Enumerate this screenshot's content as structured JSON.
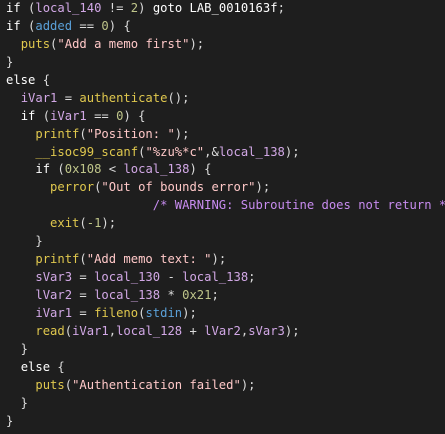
{
  "colors": {
    "background": "#1e1e1e",
    "keyword": "#ffffff",
    "function": "#e0c84e",
    "variable": "#d2a8e6",
    "global": "#5aa0d8",
    "number": "#bfc58a",
    "string": "#ffc8c8",
    "comment": "#c88cf0",
    "operator": "#dcdcdc"
  },
  "code_lines": [
    [
      [
        "kw",
        "if"
      ],
      [
        "op",
        " ("
      ],
      [
        "var",
        "local_140"
      ],
      [
        "op",
        " != "
      ],
      [
        "num",
        "2"
      ],
      [
        "op",
        ") "
      ],
      [
        "kw",
        "goto"
      ],
      [
        "label",
        " LAB_0010163f"
      ],
      [
        "op",
        ";"
      ]
    ],
    [
      [
        "kw",
        "if"
      ],
      [
        "op",
        " ("
      ],
      [
        "gvar",
        "added"
      ],
      [
        "op",
        " == "
      ],
      [
        "num",
        "0"
      ],
      [
        "op",
        ") {"
      ]
    ],
    [
      [
        "op",
        "  "
      ],
      [
        "fn",
        "puts"
      ],
      [
        "op",
        "("
      ],
      [
        "str",
        "\"Add a memo first\""
      ],
      [
        "op",
        ");"
      ]
    ],
    [
      [
        "op",
        "}"
      ]
    ],
    [
      [
        "kw",
        "else"
      ],
      [
        "op",
        " {"
      ]
    ],
    [
      [
        "op",
        "  "
      ],
      [
        "var",
        "iVar1"
      ],
      [
        "op",
        " = "
      ],
      [
        "fn",
        "authenticate"
      ],
      [
        "op",
        "();"
      ]
    ],
    [
      [
        "op",
        "  "
      ],
      [
        "kw",
        "if"
      ],
      [
        "op",
        " ("
      ],
      [
        "var",
        "iVar1"
      ],
      [
        "op",
        " == "
      ],
      [
        "num",
        "0"
      ],
      [
        "op",
        ") {"
      ]
    ],
    [
      [
        "op",
        "    "
      ],
      [
        "fn",
        "printf"
      ],
      [
        "op",
        "("
      ],
      [
        "str",
        "\"Position: \""
      ],
      [
        "op",
        ");"
      ]
    ],
    [
      [
        "op",
        "    "
      ],
      [
        "fn",
        "__isoc99_scanf"
      ],
      [
        "op",
        "("
      ],
      [
        "str",
        "\"%zu%*c\""
      ],
      [
        "op",
        ",&"
      ],
      [
        "var",
        "local_138"
      ],
      [
        "op",
        ");"
      ]
    ],
    [
      [
        "op",
        "    "
      ],
      [
        "kw",
        "if"
      ],
      [
        "op",
        " ("
      ],
      [
        "num",
        "0x108"
      ],
      [
        "op",
        " < "
      ],
      [
        "var",
        "local_138"
      ],
      [
        "op",
        ") {"
      ]
    ],
    [
      [
        "op",
        "      "
      ],
      [
        "fn",
        "perror"
      ],
      [
        "op",
        "("
      ],
      [
        "str",
        "\"Out of bounds error\""
      ],
      [
        "op",
        ");"
      ]
    ],
    [
      [
        "op",
        "                    "
      ],
      [
        "cmt",
        "/* WARNING: Subroutine does not return */"
      ]
    ],
    [
      [
        "op",
        "      "
      ],
      [
        "fn",
        "exit"
      ],
      [
        "op",
        "("
      ],
      [
        "num",
        "-1"
      ],
      [
        "op",
        ");"
      ]
    ],
    [
      [
        "op",
        "    }"
      ]
    ],
    [
      [
        "op",
        "    "
      ],
      [
        "fn",
        "printf"
      ],
      [
        "op",
        "("
      ],
      [
        "str",
        "\"Add memo text: \""
      ],
      [
        "op",
        ");"
      ]
    ],
    [
      [
        "op",
        "    "
      ],
      [
        "var",
        "sVar3"
      ],
      [
        "op",
        " = "
      ],
      [
        "var",
        "local_130"
      ],
      [
        "op",
        " - "
      ],
      [
        "var",
        "local_138"
      ],
      [
        "op",
        ";"
      ]
    ],
    [
      [
        "op",
        "    "
      ],
      [
        "var",
        "lVar2"
      ],
      [
        "op",
        " = "
      ],
      [
        "var",
        "local_138"
      ],
      [
        "op",
        " * "
      ],
      [
        "num",
        "0x21"
      ],
      [
        "op",
        ";"
      ]
    ],
    [
      [
        "op",
        "    "
      ],
      [
        "var",
        "iVar1"
      ],
      [
        "op",
        " = "
      ],
      [
        "fn",
        "fileno"
      ],
      [
        "op",
        "("
      ],
      [
        "gvar",
        "stdin"
      ],
      [
        "op",
        ");"
      ]
    ],
    [
      [
        "op",
        "    "
      ],
      [
        "fn",
        "read"
      ],
      [
        "op",
        "("
      ],
      [
        "var",
        "iVar1"
      ],
      [
        "op",
        ","
      ],
      [
        "var",
        "local_128"
      ],
      [
        "op",
        " + "
      ],
      [
        "var",
        "lVar2"
      ],
      [
        "op",
        ","
      ],
      [
        "var",
        "sVar3"
      ],
      [
        "op",
        ");"
      ]
    ],
    [
      [
        "op",
        "  }"
      ]
    ],
    [
      [
        "op",
        "  "
      ],
      [
        "kw",
        "else"
      ],
      [
        "op",
        " {"
      ]
    ],
    [
      [
        "op",
        "    "
      ],
      [
        "fn",
        "puts"
      ],
      [
        "op",
        "("
      ],
      [
        "str",
        "\"Authentication failed\""
      ],
      [
        "op",
        ");"
      ]
    ],
    [
      [
        "op",
        "  }"
      ]
    ],
    [
      [
        "op",
        "}"
      ]
    ]
  ]
}
